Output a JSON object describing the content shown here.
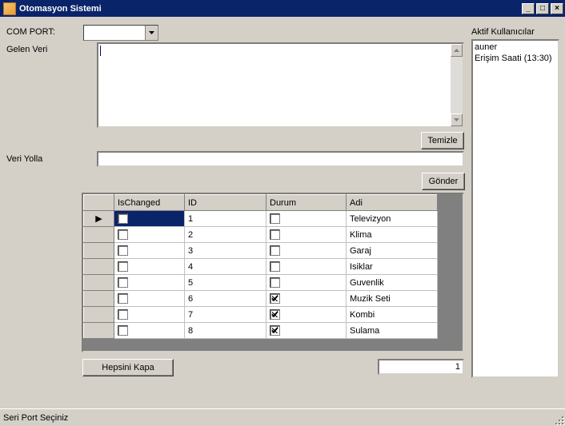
{
  "window": {
    "title": "Otomasyon Sistemi"
  },
  "labels": {
    "com_port": "COM PORT:",
    "gelen_veri": "Gelen Veri",
    "veri_yolla": "Veri Yolla",
    "aktif_kullanicilar": "Aktif Kullanıcılar"
  },
  "buttons": {
    "temizle": "Temizle",
    "gonder": "Gönder",
    "hepsini_kapa": "Hepsini Kapa"
  },
  "com_port_value": "",
  "gelen_veri_value": "",
  "veri_yolla_value": "",
  "numeric_value": "1",
  "active_users": {
    "lines": [
      "auner",
      "Erişim Saati (13:30)"
    ]
  },
  "grid": {
    "columns": [
      "IsChanged",
      "ID",
      "Durum",
      "Adi"
    ],
    "rows": [
      {
        "isChanged": false,
        "id": "1",
        "durum": false,
        "adi": "Televizyon",
        "selected": true
      },
      {
        "isChanged": false,
        "id": "2",
        "durum": false,
        "adi": "Klima",
        "selected": false
      },
      {
        "isChanged": false,
        "id": "3",
        "durum": false,
        "adi": "Garaj",
        "selected": false
      },
      {
        "isChanged": false,
        "id": "4",
        "durum": false,
        "adi": "Isiklar",
        "selected": false
      },
      {
        "isChanged": false,
        "id": "5",
        "durum": false,
        "adi": "Guvenlik",
        "selected": false
      },
      {
        "isChanged": false,
        "id": "6",
        "durum": true,
        "adi": "Muzik Seti",
        "selected": false
      },
      {
        "isChanged": false,
        "id": "7",
        "durum": true,
        "adi": "Kombi",
        "selected": false
      },
      {
        "isChanged": false,
        "id": "8",
        "durum": true,
        "adi": "Sulama",
        "selected": false
      }
    ]
  },
  "statusbar": {
    "text": "Seri Port Seçiniz"
  }
}
